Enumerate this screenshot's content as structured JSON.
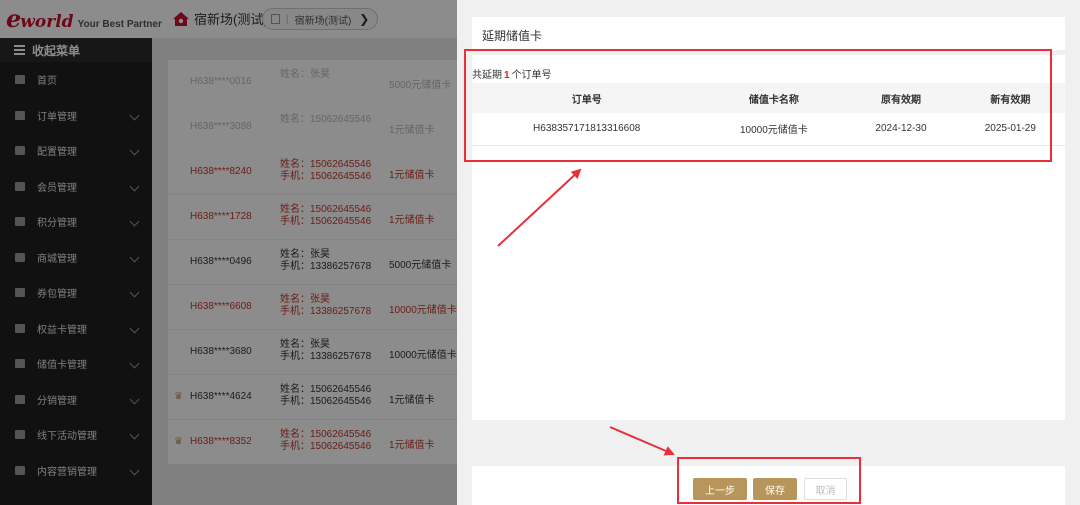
{
  "brand": {
    "logo_e": "e",
    "logo_word": "world",
    "tagline": "Your Best Partner"
  },
  "store": {
    "name": "宿新场(测试)",
    "pill_label": "宿新场(测试)"
  },
  "sidebar": {
    "collapse_label": "收起菜单",
    "items": [
      {
        "label": "首页",
        "icon": "home-icon"
      },
      {
        "label": "订单管理",
        "icon": "order-icon"
      },
      {
        "label": "配置管理",
        "icon": "config-icon"
      },
      {
        "label": "会员管理",
        "icon": "crown-icon"
      },
      {
        "label": "积分管理",
        "icon": "points-icon"
      },
      {
        "label": "商城管理",
        "icon": "shop-icon"
      },
      {
        "label": "券包管理",
        "icon": "coupon-icon"
      },
      {
        "label": "权益卡管理",
        "icon": "card-icon"
      },
      {
        "label": "储值卡管理",
        "icon": "stored-card-icon"
      },
      {
        "label": "分销管理",
        "icon": "distribution-icon"
      },
      {
        "label": "线下活动管理",
        "icon": "activity-icon"
      },
      {
        "label": "内容营销管理",
        "icon": "marketing-icon"
      }
    ]
  },
  "list": {
    "rows": [
      {
        "id": "H638****0016",
        "name": "姓名：张昊",
        "phone": "",
        "card": "5000元储值卡",
        "red": false,
        "vip": false
      },
      {
        "id": "H638****3088",
        "name": "姓名：15062645546",
        "phone": "",
        "card": "1元储值卡",
        "red": false,
        "vip": false
      },
      {
        "id": "H638****8240",
        "name": "姓名：15062645546",
        "phone": "手机：15062645546",
        "card": "1元储值卡",
        "red": true,
        "vip": false
      },
      {
        "id": "H638****1728",
        "name": "姓名：15062645546",
        "phone": "手机：15062645546",
        "card": "1元储值卡",
        "red": true,
        "vip": false
      },
      {
        "id": "H638****0496",
        "name": "姓名：张昊",
        "phone": "手机：13386257678",
        "card": "5000元储值卡",
        "red": false,
        "vip": false
      },
      {
        "id": "H638****6608",
        "name": "姓名：张昊",
        "phone": "手机：13386257678",
        "card": "10000元储值卡",
        "red": true,
        "vip": false
      },
      {
        "id": "H638****3680",
        "name": "姓名：张昊",
        "phone": "手机：13386257678",
        "card": "10000元储值卡",
        "red": false,
        "vip": false
      },
      {
        "id": "H638****4624",
        "name": "姓名：15062645546",
        "phone": "手机：15062645546",
        "card": "1元储值卡",
        "red": false,
        "vip": true
      },
      {
        "id": "H638****8352",
        "name": "姓名：15062645546",
        "phone": "手机：15062645546",
        "card": "1元储值卡",
        "red": true,
        "vip": true
      }
    ]
  },
  "drawer": {
    "title": "延期储值卡",
    "summary_prefix": "共延期",
    "summary_count": "1",
    "summary_suffix": "个订单号",
    "columns": [
      "订单号",
      "储值卡名称",
      "原有效期",
      "新有效期"
    ],
    "rows": [
      [
        "H638357171813316608",
        "10000元储值卡",
        "2024-12-30",
        "2025-01-29"
      ]
    ],
    "buttons": {
      "prev": "上一步",
      "save": "保存",
      "cancel": "取消"
    }
  },
  "colors": {
    "accent": "#b8955a",
    "highlight": "#e8303a",
    "brand": "#c8102e",
    "sidebar_bg": "#1f1f1f"
  }
}
